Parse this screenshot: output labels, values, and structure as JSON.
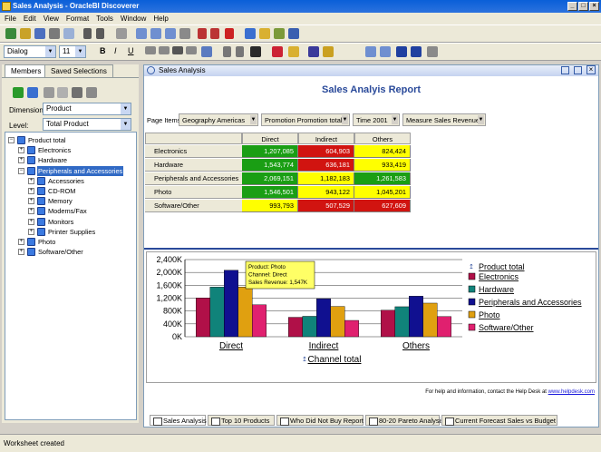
{
  "window": {
    "title": "Sales Analysis - OracleBI Discoverer"
  },
  "menu": [
    "File",
    "Edit",
    "View",
    "Format",
    "Tools",
    "Window",
    "Help"
  ],
  "format_toolbar": {
    "font": "Dialog",
    "size": "11",
    "bold": "B",
    "italic": "I",
    "underline": "U"
  },
  "left": {
    "tabs": [
      "Members",
      "Saved Selections"
    ],
    "dimension_label": "Dimension:",
    "dimension_value": "Product",
    "level_label": "Level:",
    "level_value": "Total Product",
    "tree": [
      {
        "label": "Product total",
        "depth": 0,
        "expander": "−"
      },
      {
        "label": "Electronics",
        "depth": 1,
        "expander": "+"
      },
      {
        "label": "Hardware",
        "depth": 1,
        "expander": "+"
      },
      {
        "label": "Peripherals and Accessories",
        "depth": 1,
        "expander": "−",
        "selected": true
      },
      {
        "label": "Accessories",
        "depth": 2,
        "expander": "+"
      },
      {
        "label": "CD-ROM",
        "depth": 2,
        "expander": "+"
      },
      {
        "label": "Memory",
        "depth": 2,
        "expander": "+"
      },
      {
        "label": "Modems/Fax",
        "depth": 2,
        "expander": "+"
      },
      {
        "label": "Monitors",
        "depth": 2,
        "expander": "+"
      },
      {
        "label": "Printer Supplies",
        "depth": 2,
        "expander": "+"
      },
      {
        "label": "Photo",
        "depth": 1,
        "expander": "+"
      },
      {
        "label": "Software/Other",
        "depth": 1,
        "expander": "+"
      }
    ]
  },
  "worksheet": {
    "panel_title": "Sales Analysis",
    "report_title": "Sales Analyis Report",
    "page_items_label": "Page Items:",
    "page_items": [
      {
        "name": "Geography",
        "value": "Americas"
      },
      {
        "name": "Promotion",
        "value": "Promotion total"
      },
      {
        "name": "Time",
        "value": "2001"
      },
      {
        "name": "Measure",
        "value": "Sales Revenue"
      }
    ],
    "columns": [
      "Direct",
      "Indirect",
      "Others"
    ],
    "rows": [
      {
        "label": "Electronics",
        "cells": [
          {
            "v": "1,207,085",
            "c": "g"
          },
          {
            "v": "604,903",
            "c": "r"
          },
          {
            "v": "824,424",
            "c": "y"
          }
        ]
      },
      {
        "label": "Hardware",
        "cells": [
          {
            "v": "1,543,774",
            "c": "g"
          },
          {
            "v": "636,181",
            "c": "r"
          },
          {
            "v": "933,419",
            "c": "y"
          }
        ]
      },
      {
        "label": "Peripherals and Accessories",
        "cells": [
          {
            "v": "2,069,151",
            "c": "g"
          },
          {
            "v": "1,182,183",
            "c": "y"
          },
          {
            "v": "1,261,583",
            "c": "g"
          }
        ]
      },
      {
        "label": "Photo",
        "cells": [
          {
            "v": "1,546,501",
            "c": "g"
          },
          {
            "v": "943,122",
            "c": "y"
          },
          {
            "v": "1,045,201",
            "c": "y"
          }
        ]
      },
      {
        "label": "Software/Other",
        "cells": [
          {
            "v": "993,793",
            "c": "y"
          },
          {
            "v": "507,529",
            "c": "r"
          },
          {
            "v": "627,609",
            "c": "r"
          }
        ]
      }
    ],
    "footer": "For help and information, contact the Help Desk at",
    "footer_link": "www.helpdesk.com",
    "sheet_tabs": [
      "Sales Analysis",
      "Top 10 Products",
      "Who Did Not Buy Report",
      "80-20 Pareto Analysis",
      "Current Forecast Sales vs Budget"
    ]
  },
  "chart_data": {
    "type": "bar",
    "categories": [
      "Direct",
      "Indirect",
      "Others"
    ],
    "xlabel": "Channel total",
    "ylim": [
      0,
      2400000
    ],
    "yticks": [
      "0K",
      "400K",
      "800K",
      "1,200K",
      "1,600K",
      "2,000K",
      "2,400K"
    ],
    "legend_title": "Product total",
    "legend_position": "right",
    "series": [
      {
        "name": "Electronics",
        "color": "#b01048",
        "values": [
          1207085,
          604903,
          824424
        ]
      },
      {
        "name": "Hardware",
        "color": "#10837a",
        "values": [
          1543774,
          636181,
          933419
        ]
      },
      {
        "name": "Peripherals and Accessories",
        "color": "#101090",
        "values": [
          2069151,
          1182183,
          1261583
        ]
      },
      {
        "name": "Photo",
        "color": "#e0a010",
        "values": [
          1546501,
          943122,
          1045201
        ]
      },
      {
        "name": "Software/Other",
        "color": "#e0206f",
        "values": [
          993793,
          507529,
          627609
        ]
      }
    ],
    "tooltip": [
      "Product: Photo",
      "Channel: Direct",
      "Sales Revenue: 1,547K"
    ]
  },
  "status": "Worksheet created"
}
